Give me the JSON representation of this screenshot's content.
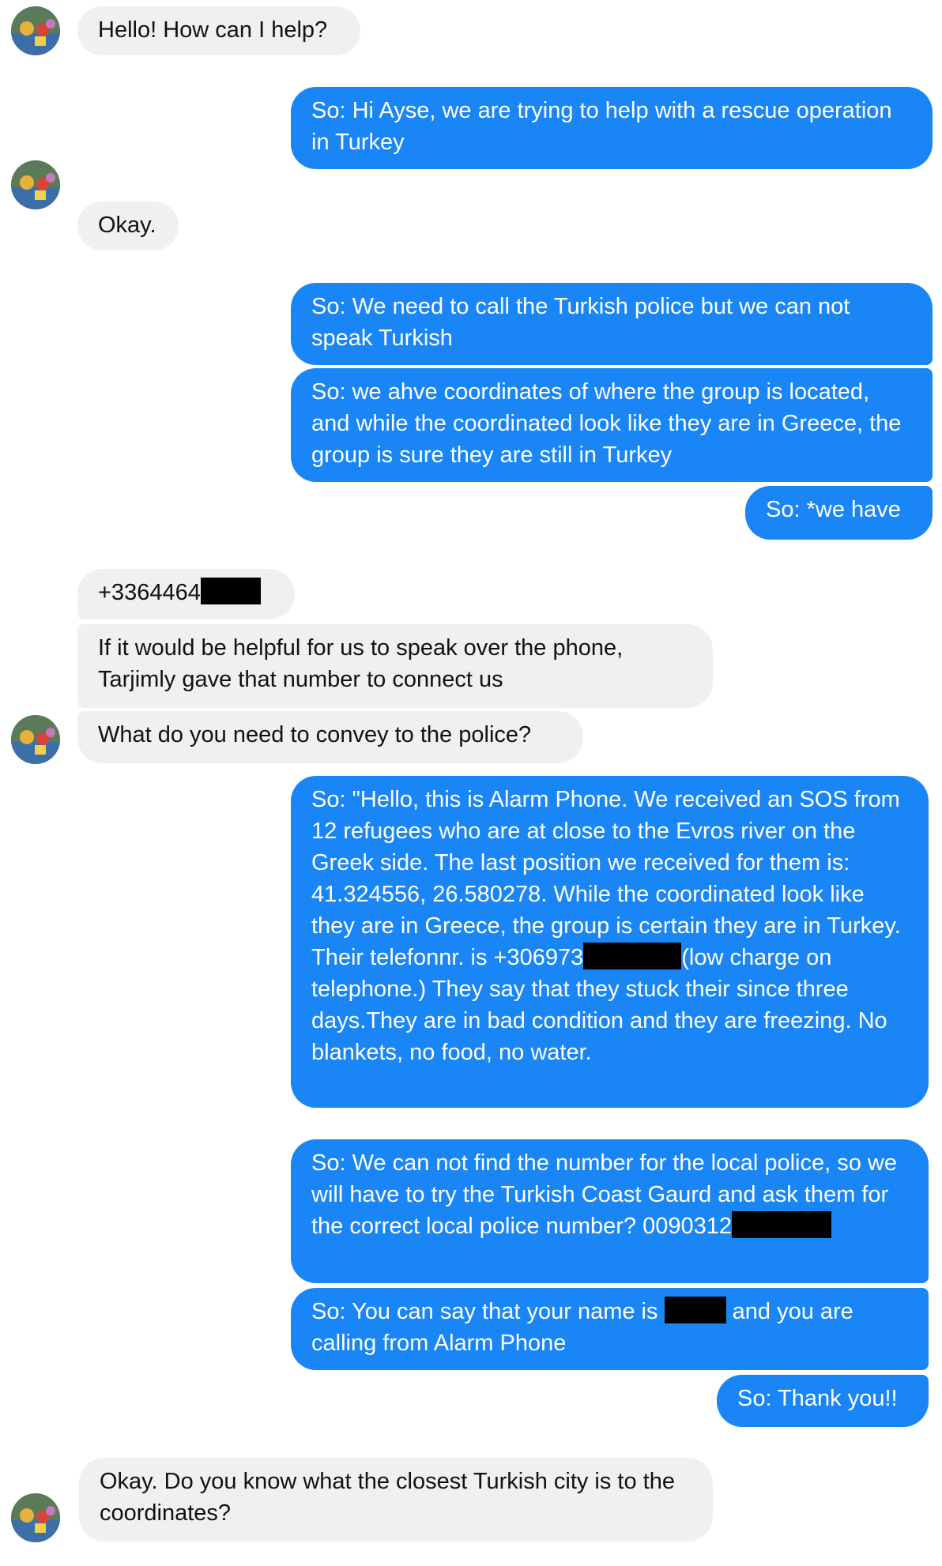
{
  "colors": {
    "outgoing_bubble": "#1a86f5",
    "incoming_bubble": "#f0f0f0",
    "redaction": "#000000"
  },
  "avatar": {
    "icon": "contact-avatar-icon"
  },
  "messages": [
    {
      "from": "them",
      "text": "Hello! How can I help?"
    },
    {
      "from": "me",
      "text": "So: Hi Ayse, we are trying to help with a rescue operation in Turkey"
    },
    {
      "from": "them",
      "text": "Okay."
    },
    {
      "from": "me",
      "text": "So: We need to call the Turkish police but we can not speak Turkish"
    },
    {
      "from": "me",
      "text": "So: we ahve coordinates of where the group is located, and while the coordinated look like they are in Greece, the group is sure they are still in Turkey"
    },
    {
      "from": "me",
      "text": "So: *we have"
    },
    {
      "from": "them",
      "text": "+3364464"
    },
    {
      "from": "them",
      "text": "If it would be helpful for us to speak over the phone, Tarjimly gave that number to connect us"
    },
    {
      "from": "them",
      "text": "What do you need to convey to the police?"
    },
    {
      "from": "me",
      "text_a": "So: \"Hello, this is Alarm Phone. We received an SOS from 12 refugees who are at close to the Evros river on the Greek side. The last position we received for them is: 41.324556, 26.580278. While the coordinated look like they are in Greece, the group is certain they are in Turkey. Their telefonnr. is +306973",
      "text_b": "(low charge on telephone.) They say that they stuck their since three days.They are in bad condition and they are freezing. No blankets, no food, no water."
    },
    {
      "from": "me",
      "text": "So: We can not find the number for the local police, so we will have to try the Turkish Coast Gaurd and ask them for the correct local police number? 0090312"
    },
    {
      "from": "me",
      "text_a": "So: You can say that your name is",
      "text_b": "and you are calling from Alarm Phone"
    },
    {
      "from": "me",
      "text": "So: Thank you!!"
    },
    {
      "from": "them",
      "text": "Okay. Do you know what the closest Turkish city is to the coordinates?"
    }
  ]
}
